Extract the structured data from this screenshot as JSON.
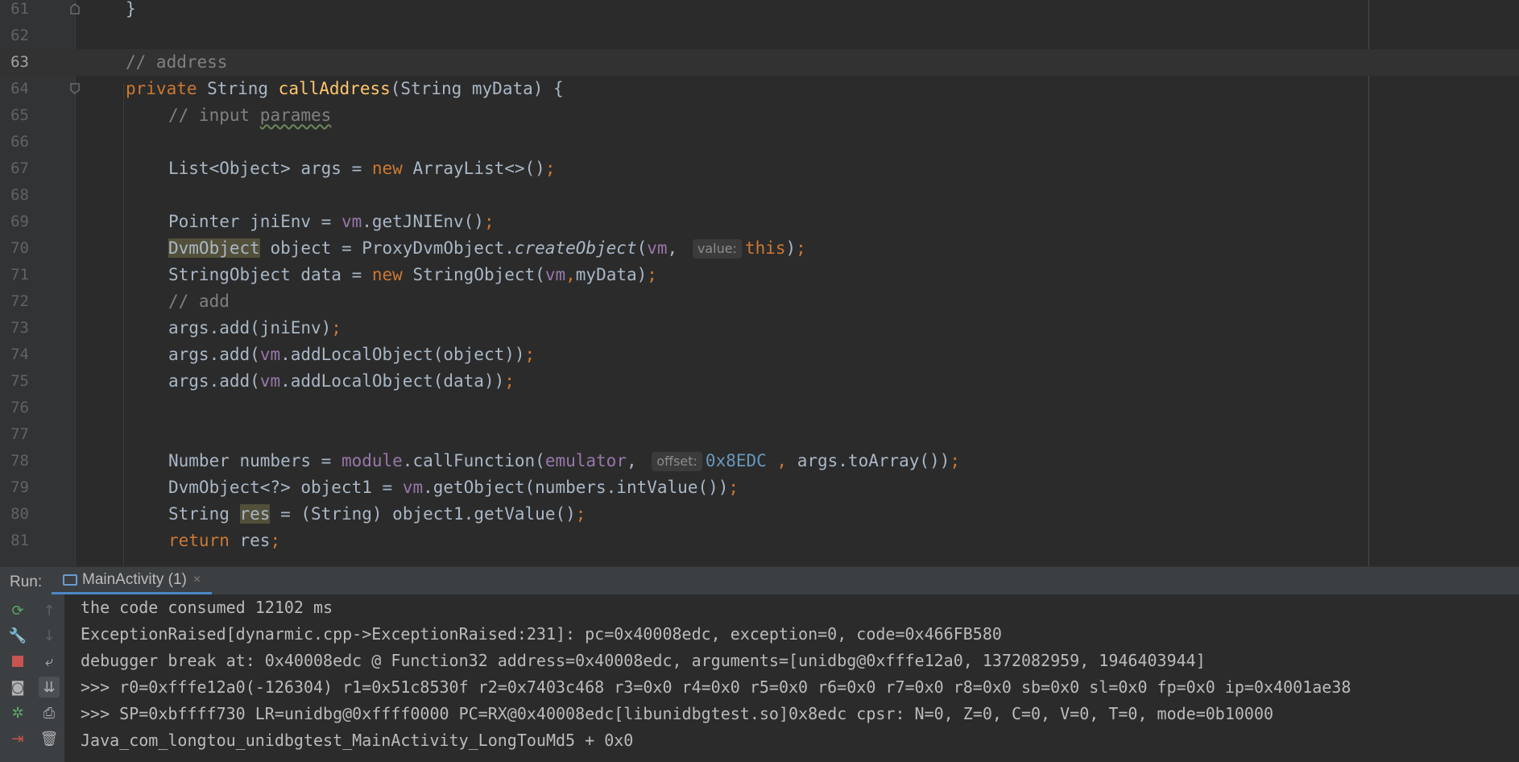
{
  "editor": {
    "current_line": "63",
    "lines": [
      {
        "n": "61",
        "parts": [
          "}"
        ]
      },
      {
        "n": "62",
        "parts": []
      },
      {
        "n": "63",
        "parts": [
          "// address"
        ]
      },
      {
        "n": "64",
        "parts": [
          "private",
          " String ",
          "callAddress",
          "(String myData) {"
        ]
      },
      {
        "n": "65",
        "parts": [
          "// input ",
          "parames"
        ]
      },
      {
        "n": "66",
        "parts": []
      },
      {
        "n": "67",
        "parts": [
          "List<Object> args = ",
          "new",
          " ArrayList<>()",
          ";"
        ]
      },
      {
        "n": "68",
        "parts": []
      },
      {
        "n": "69",
        "parts": [
          "Pointer jniEnv = ",
          "vm",
          ".getJNIEnv()",
          ";"
        ]
      },
      {
        "n": "70",
        "parts": [
          "DvmObject",
          " object = ProxyDvmObject.",
          "createObject",
          "(",
          "vm",
          ", ",
          "value:",
          "this",
          ")",
          ";"
        ]
      },
      {
        "n": "71",
        "parts": [
          "StringObject data = ",
          "new",
          " StringObject(",
          "vm",
          ",",
          "myData)",
          ";"
        ]
      },
      {
        "n": "72",
        "parts": [
          "// add"
        ]
      },
      {
        "n": "73",
        "parts": [
          "args.add(jniEnv)",
          ";"
        ]
      },
      {
        "n": "74",
        "parts": [
          "args.add(",
          "vm",
          ".addLocalObject(object))",
          ";"
        ]
      },
      {
        "n": "75",
        "parts": [
          "args.add(",
          "vm",
          ".addLocalObject(data))",
          ";"
        ]
      },
      {
        "n": "76",
        "parts": []
      },
      {
        "n": "77",
        "parts": []
      },
      {
        "n": "78",
        "parts": [
          "Number numbers = ",
          "module",
          ".callFunction(",
          "emulator",
          ", ",
          "offset:",
          "0x8EDC",
          " , ",
          "args.toArray())",
          ";"
        ]
      },
      {
        "n": "79",
        "parts": [
          "DvmObject<?> object1 = ",
          "vm",
          ".getObject(numbers.intValue())",
          ";"
        ]
      },
      {
        "n": "80",
        "parts": [
          "String ",
          "res",
          " = (String) object1.getValue()",
          ";"
        ]
      },
      {
        "n": "81",
        "parts": [
          "return",
          " res",
          ";"
        ]
      }
    ]
  },
  "run_panel": {
    "label": "Run:",
    "tab_title": "MainActivity (1)",
    "tab_close": "×",
    "console_lines": [
      "the code consumed 12102 ms",
      "ExceptionRaised[dynarmic.cpp->ExceptionRaised:231]: pc=0x40008edc, exception=0, code=0x466FB580",
      "debugger break at: 0x40008edc @ Function32 address=0x40008edc, arguments=[unidbg@0xfffe12a0, 1372082959, 1946403944]",
      ">>> r0=0xfffe12a0(-126304) r1=0x51c8530f r2=0x7403c468 r3=0x0 r4=0x0 r5=0x0 r6=0x0 r7=0x0 r8=0x0 sb=0x0 sl=0x0 fp=0x0 ip=0x4001ae38",
      ">>> SP=0xbffff730 LR=unidbg@0xffff0000 PC=RX@0x40008edc[libunidbgtest.so]0x8edc cpsr: N=0, Z=0, C=0, V=0, T=0, mode=0b10000",
      "Java_com_longtou_unidbgtest_MainActivity_LongTouMd5 + 0x0"
    ]
  },
  "toolbar_icons": [
    "rerun-icon",
    "up-arrow-icon",
    "wrench-icon",
    "down-arrow-icon",
    "stop-icon",
    "soft-wrap-icon",
    "camera-icon",
    "scroll-to-end-icon",
    "debug-gear-icon",
    "print-icon",
    "exit-icon",
    "trash-icon"
  ]
}
